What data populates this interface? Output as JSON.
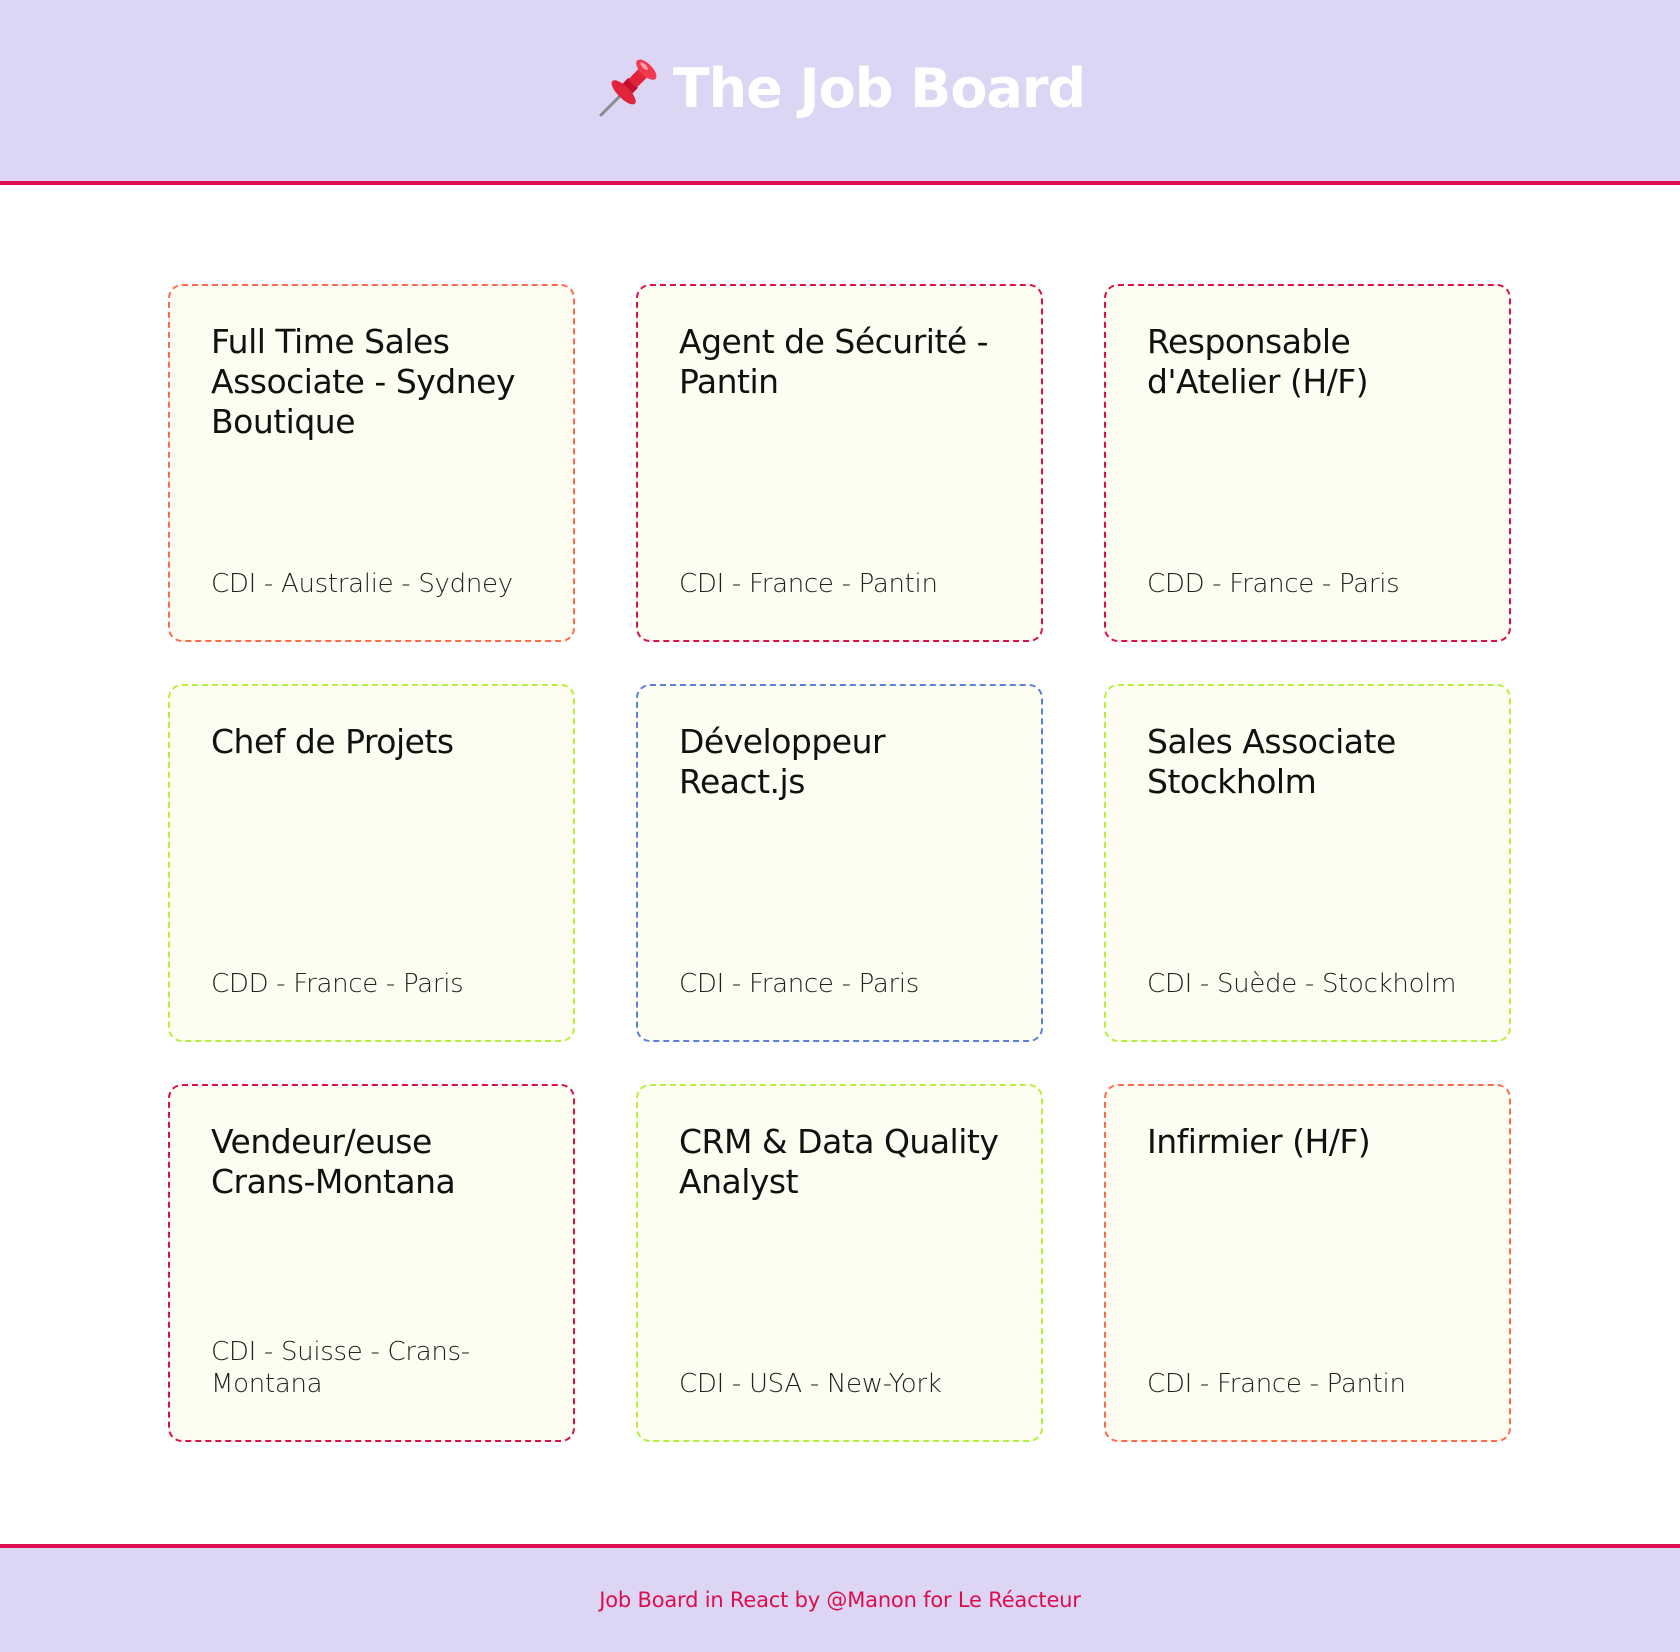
{
  "header": {
    "icon": "pushpin-icon",
    "title": "The Job Board"
  },
  "jobs": [
    {
      "title": "Full Time Sales Associate - Sydney Boutique",
      "meta": "CDI - Australie - Sydney",
      "border_color": "#ff6a4c"
    },
    {
      "title": "Agent de Sécurité - Pantin",
      "meta": "CDI - France - Pantin",
      "border_color": "#dc0e4e"
    },
    {
      "title": "Responsable d'Atelier (H/F)",
      "meta": "CDD - France - Paris",
      "border_color": "#dc0e4e"
    },
    {
      "title": "Chef de Projets",
      "meta": "CDD - France - Paris",
      "border_color": "#b5f03c"
    },
    {
      "title": "Développeur React.js",
      "meta": "CDI - France - Paris",
      "border_color": "#5b7fe0"
    },
    {
      "title": "Sales Associate Stockholm",
      "meta": "CDI - Suède - Stockholm",
      "border_color": "#b5f03c"
    },
    {
      "title": "Vendeur/euse Crans-Montana",
      "meta": "CDI - Suisse - Crans-Montana",
      "border_color": "#dc0e4e"
    },
    {
      "title": "CRM & Data Quality Analyst",
      "meta": "CDI - USA - New-York",
      "border_color": "#b5f03c"
    },
    {
      "title": "Infirmier (H/F)",
      "meta": "CDI - France - Pantin",
      "border_color": "#ff6a4c"
    }
  ],
  "footer": {
    "text": "Job Board in React by @Manon for Le Réacteur"
  },
  "colors": {
    "header_bg": "#dcd5f3",
    "accent": "#dc0e4e",
    "card_bg": "#fdfdf1"
  }
}
